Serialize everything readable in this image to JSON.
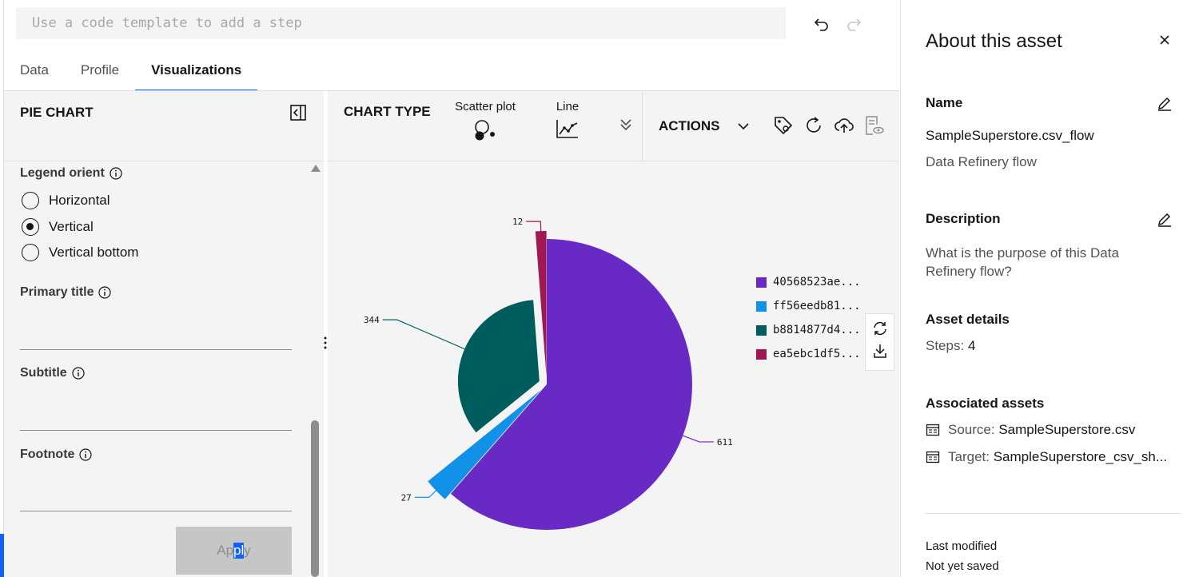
{
  "step_input": {
    "placeholder": "Use a code template to add a step"
  },
  "toolbar": {
    "undo_icon": "undo-icon",
    "redo_icon": "redo-icon"
  },
  "tabs": [
    {
      "label": "Data",
      "active": false
    },
    {
      "label": "Profile",
      "active": false
    },
    {
      "label": "Visualizations",
      "active": true
    }
  ],
  "left_panel": {
    "title": "PIE CHART",
    "legend_orient": {
      "label": "Legend orient",
      "options": [
        "Horizontal",
        "Vertical",
        "Vertical bottom"
      ],
      "selected": "Vertical"
    },
    "primary_title": {
      "label": "Primary title",
      "value": ""
    },
    "subtitle": {
      "label": "Subtitle",
      "value": ""
    },
    "footnote": {
      "label": "Footnote",
      "value": ""
    },
    "apply": {
      "before": "Ap",
      "selected": "pl",
      "after": "y"
    }
  },
  "chart_toolbar": {
    "chart_type_label": "CHART TYPE",
    "types": [
      {
        "label": "Scatter plot",
        "icon": "scatter-plot-icon"
      },
      {
        "label": "Line",
        "icon": "line-chart-icon"
      }
    ],
    "actions_label": "ACTIONS"
  },
  "chart_data": {
    "type": "pie",
    "slices": [
      {
        "label": "40568523ae...",
        "value": 611,
        "color": "#6929c4"
      },
      {
        "label": "ff56eedb81...",
        "value": 27,
        "color": "#1192e8"
      },
      {
        "label": "b8814877d4...",
        "value": 344,
        "color": "#005d5d"
      },
      {
        "label": "ea5ebc1df5...",
        "value": 12,
        "color": "#9f1853"
      }
    ],
    "legend_position": "right",
    "data_labels": true
  },
  "about": {
    "title": "About this asset",
    "name_heading": "Name",
    "name_value": "SampleSuperstore.csv_flow",
    "type_value": "Data Refinery flow",
    "description_heading": "Description",
    "description_placeholder": "What is the purpose of this Data Refinery flow?",
    "asset_details_heading": "Asset details",
    "steps_label": "Steps:",
    "steps_value": "4",
    "associated_heading": "Associated assets",
    "source_label": "Source:",
    "source_value": "SampleSuperstore.csv",
    "target_label": "Target:",
    "target_value": "SampleSuperstore_csv_sh...",
    "last_modified_label": "Last modified",
    "last_modified_value": "Not yet saved"
  }
}
